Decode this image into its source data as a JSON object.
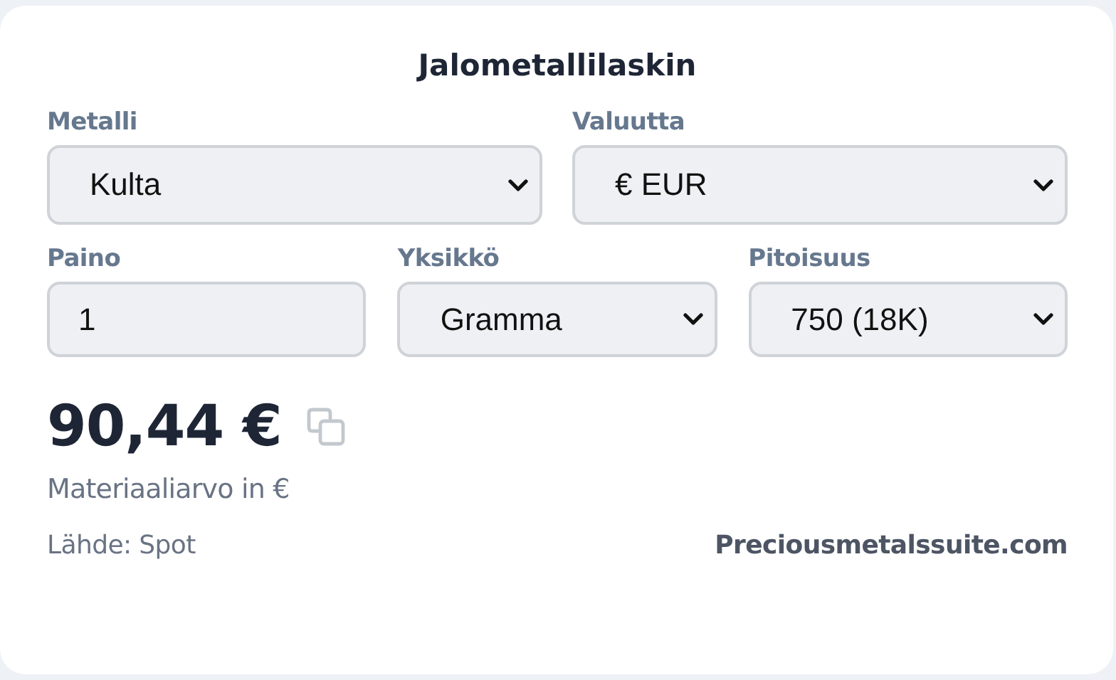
{
  "title": "Jalometallilaskin",
  "rows": [
    [
      {
        "kind": "select",
        "label": "Metalli",
        "value": "Kulta"
      },
      {
        "kind": "select",
        "label": "Valuutta",
        "value": "€ EUR"
      }
    ],
    [
      {
        "kind": "input",
        "label": "Paino",
        "value": "1"
      },
      {
        "kind": "select",
        "label": "Yksikkö",
        "value": "Gramma"
      },
      {
        "kind": "select",
        "label": "Pitoisuus",
        "value": "750 (18K)"
      }
    ]
  ],
  "result": {
    "value": "90,44 €",
    "caption": "Materiaaliarvo in €"
  },
  "footer": {
    "source": "Lähde: Spot",
    "link": "Preciousmetalssuite.com"
  }
}
